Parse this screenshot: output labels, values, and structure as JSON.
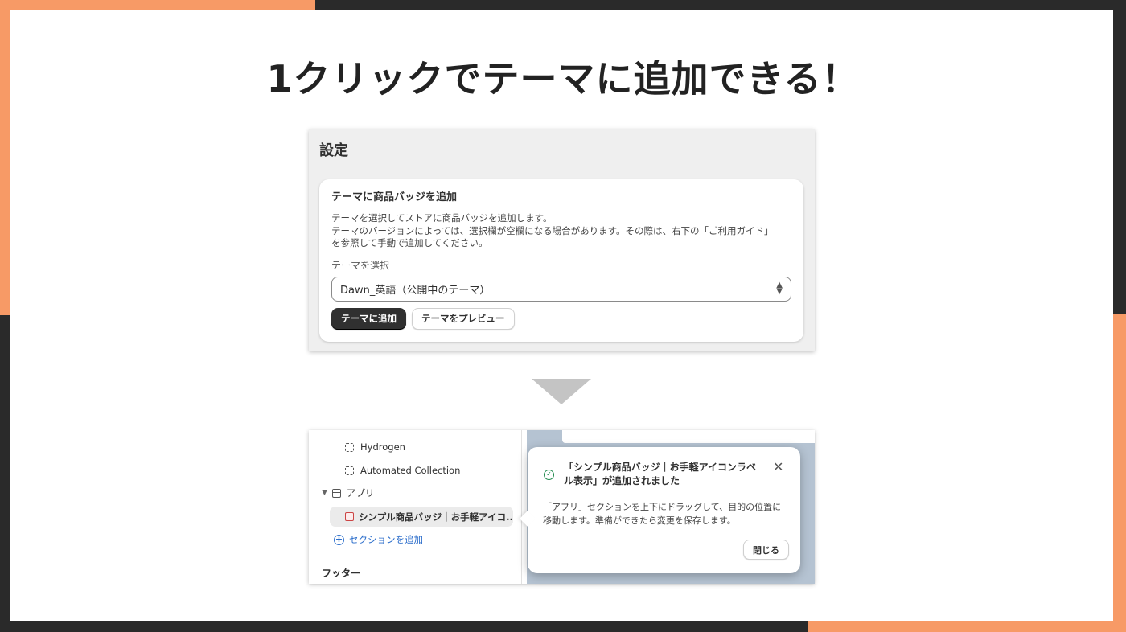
{
  "headline": "1クリックでテーマに追加できる！",
  "settings": {
    "title": "設定",
    "card": {
      "title": "テーマに商品バッジを追加",
      "desc_line1": "テーマを選択してストアに商品バッジを追加します。",
      "desc_line2": "テーマのバージョンによっては、選択欄が空欄になる場合があります。その際は、右下の「ご利用ガイド」",
      "desc_line3": "を参照して手動で追加してください。",
      "field_label": "テーマを選択",
      "select_value": "Dawn_英語（公開中のテーマ）",
      "add_button": "テーマに追加",
      "preview_button": "テーマをプレビュー"
    }
  },
  "editor": {
    "sidebar": {
      "item_hydrogen": "Hydrogen",
      "item_automated": "Automated Collection",
      "group_apps": "アプリ",
      "selected_app": "シンプル商品バッジ｜お手軽アイコ...",
      "add_section": "セクションを追加",
      "footer": "フッター"
    },
    "popover": {
      "title": "「シンプル商品バッジ｜お手軽アイコンラベル表示」が追加されました",
      "body": "「アプリ」セクションを上下にドラッグして、目的の位置に移動します。準備ができたら変更を保存します。",
      "close_button": "閉じる"
    }
  },
  "colors": {
    "accent_orange": "#f79a66",
    "primary_button": "#303030",
    "link_blue": "#2c6ecb",
    "success_green": "#1f8a4c"
  }
}
